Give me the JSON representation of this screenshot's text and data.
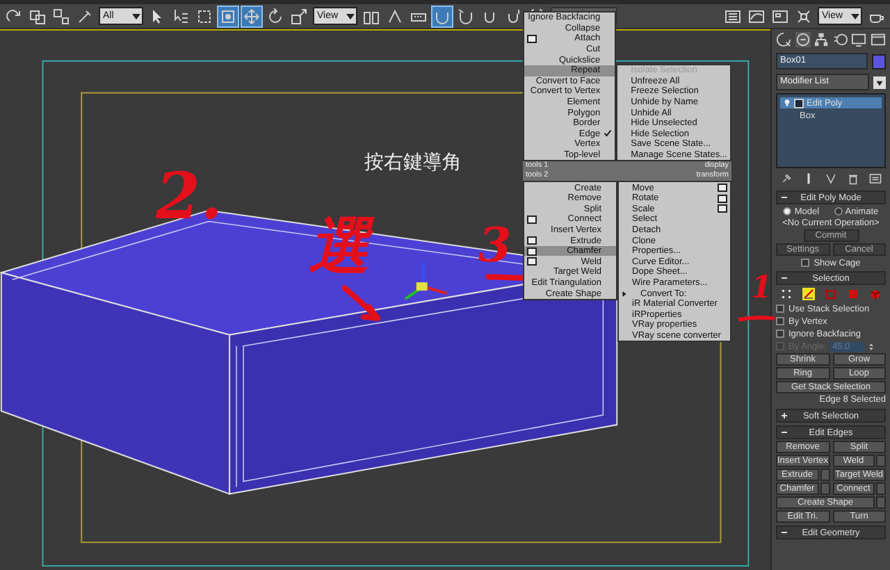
{
  "toolbar": {
    "tools_left": [
      {
        "selected": false
      },
      {
        "selected": false
      },
      {
        "selected": false
      },
      {
        "selected": false
      }
    ],
    "selection_filter": "All",
    "tools_select": [
      {
        "selected": false
      },
      {
        "selected": false
      },
      {
        "selected": false
      },
      {
        "selected": true
      },
      {
        "selected": true
      },
      {
        "selected": false
      },
      {
        "selected": false
      }
    ],
    "reference_coordinate": "View",
    "tools_snap": [
      {
        "selected": false
      },
      {
        "selected": false
      },
      {
        "selected": false
      },
      {
        "selected": true
      },
      {
        "selected": false
      },
      {
        "selected": false
      },
      {
        "selected": false
      }
    ],
    "tools_scene": [
      {
        "selected": false
      },
      {
        "selected": false
      },
      {
        "selected": false
      },
      {
        "selected": false
      }
    ],
    "view_dropdown": "View",
    "tools_render": [
      {
        "selected": false
      }
    ]
  },
  "viewport": {
    "caption": "按右鍵導角"
  },
  "annotations": [
    {
      "text": "2."
    },
    {
      "text": "選"
    },
    {
      "text": "3"
    },
    {
      "text": "1"
    }
  ],
  "quad_menu": {
    "tools_1": {
      "title": "tools 1",
      "items": [
        {
          "label": "Ignore Backfacing",
          "options": false,
          "checked": false,
          "highlighted": false,
          "disabled": false,
          "submenu": false
        },
        {
          "label": "Collapse",
          "options": false,
          "checked": false,
          "highlighted": false,
          "disabled": false,
          "submenu": false
        },
        {
          "label": "Attach",
          "options": true,
          "checked": false,
          "highlighted": false,
          "disabled": false,
          "submenu": false
        },
        {
          "label": "Cut",
          "options": false,
          "checked": false,
          "highlighted": false,
          "disabled": false,
          "submenu": false
        },
        {
          "label": "Quickslice",
          "options": false,
          "checked": false,
          "highlighted": false,
          "disabled": false,
          "submenu": false
        },
        {
          "label": "Repeat",
          "options": false,
          "checked": false,
          "highlighted": true,
          "disabled": false,
          "submenu": false
        },
        {
          "label": "Convert to Face",
          "options": false,
          "checked": false,
          "highlighted": false,
          "disabled": false,
          "submenu": false
        },
        {
          "label": "Convert to Vertex",
          "options": false,
          "checked": false,
          "highlighted": false,
          "disabled": false,
          "submenu": false
        },
        {
          "label": "Element",
          "options": false,
          "checked": false,
          "highlighted": false,
          "disabled": false,
          "submenu": false
        },
        {
          "label": "Polygon",
          "options": false,
          "checked": false,
          "highlighted": false,
          "disabled": false,
          "submenu": false
        },
        {
          "label": "Border",
          "options": false,
          "checked": false,
          "highlighted": false,
          "disabled": false,
          "submenu": false
        },
        {
          "label": "Edge",
          "options": false,
          "checked": true,
          "highlighted": false,
          "disabled": false,
          "submenu": false
        },
        {
          "label": "Vertex",
          "options": false,
          "checked": false,
          "highlighted": false,
          "disabled": false,
          "submenu": false
        },
        {
          "label": "Top-level",
          "options": false,
          "checked": false,
          "highlighted": false,
          "disabled": false,
          "submenu": false
        }
      ]
    },
    "display": {
      "title": "display",
      "items": [
        {
          "label": "Isolate Selection",
          "options": false,
          "checked": false,
          "highlighted": false,
          "disabled": true,
          "submenu": false
        },
        {
          "label": "Unfreeze All",
          "options": false,
          "checked": false,
          "highlighted": false,
          "disabled": false,
          "submenu": false
        },
        {
          "label": "Freeze Selection",
          "options": false,
          "checked": false,
          "highlighted": false,
          "disabled": false,
          "submenu": false
        },
        {
          "label": "Unhide by Name",
          "options": false,
          "checked": false,
          "highlighted": false,
          "disabled": false,
          "submenu": false
        },
        {
          "label": "Unhide All",
          "options": false,
          "checked": false,
          "highlighted": false,
          "disabled": false,
          "submenu": false
        },
        {
          "label": "Hide Unselected",
          "options": false,
          "checked": false,
          "highlighted": false,
          "disabled": false,
          "submenu": false
        },
        {
          "label": "Hide Selection",
          "options": false,
          "checked": false,
          "highlighted": false,
          "disabled": false,
          "submenu": false
        },
        {
          "label": "Save Scene State...",
          "options": false,
          "checked": false,
          "highlighted": false,
          "disabled": false,
          "submenu": false
        },
        {
          "label": "Manage Scene States...",
          "options": false,
          "checked": false,
          "highlighted": false,
          "disabled": false,
          "submenu": false
        }
      ]
    },
    "tools_2": {
      "title": "tools 2",
      "items": [
        {
          "label": "Create",
          "options": false,
          "checked": false,
          "highlighted": false,
          "disabled": false,
          "submenu": false
        },
        {
          "label": "Remove",
          "options": false,
          "checked": false,
          "highlighted": false,
          "disabled": false,
          "submenu": false
        },
        {
          "label": "Split",
          "options": false,
          "checked": false,
          "highlighted": false,
          "disabled": false,
          "submenu": false
        },
        {
          "label": "Connect",
          "options": true,
          "checked": false,
          "highlighted": false,
          "disabled": false,
          "submenu": false
        },
        {
          "label": "Insert Vertex",
          "options": false,
          "checked": false,
          "highlighted": false,
          "disabled": false,
          "submenu": false
        },
        {
          "label": "Extrude",
          "options": true,
          "checked": false,
          "highlighted": false,
          "disabled": false,
          "submenu": false
        },
        {
          "label": "Chamfer",
          "options": true,
          "checked": false,
          "highlighted": true,
          "disabled": false,
          "submenu": false
        },
        {
          "label": "Weld",
          "options": true,
          "checked": false,
          "highlighted": false,
          "disabled": false,
          "submenu": false
        },
        {
          "label": "Target Weld",
          "options": false,
          "checked": false,
          "highlighted": false,
          "disabled": false,
          "submenu": false
        },
        {
          "label": "Edit Triangulation",
          "options": false,
          "checked": false,
          "highlighted": false,
          "disabled": false,
          "submenu": false
        },
        {
          "label": "Create Shape",
          "options": false,
          "checked": false,
          "highlighted": false,
          "disabled": false,
          "submenu": false
        }
      ]
    },
    "transform": {
      "title": "transform",
      "items": [
        {
          "label": "Move",
          "options": true,
          "checked": false,
          "highlighted": false,
          "disabled": false,
          "submenu": false
        },
        {
          "label": "Rotate",
          "options": true,
          "checked": false,
          "highlighted": false,
          "disabled": false,
          "submenu": false
        },
        {
          "label": "Scale",
          "options": true,
          "checked": false,
          "highlighted": false,
          "disabled": false,
          "submenu": false
        },
        {
          "label": "Select",
          "options": false,
          "checked": false,
          "highlighted": false,
          "disabled": false,
          "submenu": false
        },
        {
          "label": "Detach",
          "options": false,
          "checked": false,
          "highlighted": false,
          "disabled": false,
          "submenu": false
        },
        {
          "label": "Clone",
          "options": false,
          "checked": false,
          "highlighted": false,
          "disabled": false,
          "submenu": false
        },
        {
          "label": "Properties...",
          "options": false,
          "checked": false,
          "highlighted": false,
          "disabled": false,
          "submenu": false
        },
        {
          "label": "Curve Editor...",
          "options": false,
          "checked": false,
          "highlighted": false,
          "disabled": false,
          "submenu": false
        },
        {
          "label": "Dope Sheet...",
          "options": false,
          "checked": false,
          "highlighted": false,
          "disabled": false,
          "submenu": false
        },
        {
          "label": "Wire Parameters...",
          "options": false,
          "checked": false,
          "highlighted": false,
          "disabled": false,
          "submenu": false
        },
        {
          "label": "Convert To:",
          "options": false,
          "checked": false,
          "highlighted": false,
          "disabled": false,
          "submenu": true
        },
        {
          "label": "iR Material Converter",
          "options": false,
          "checked": false,
          "highlighted": false,
          "disabled": false,
          "submenu": false
        },
        {
          "label": "iRProperties",
          "options": false,
          "checked": false,
          "highlighted": false,
          "disabled": false,
          "submenu": false
        },
        {
          "label": "VRay properties",
          "options": false,
          "checked": false,
          "highlighted": false,
          "disabled": false,
          "submenu": false
        },
        {
          "label": "VRay scene converter",
          "options": false,
          "checked": false,
          "highlighted": false,
          "disabled": false,
          "submenu": false
        }
      ]
    }
  },
  "command_panel": {
    "tabs": [
      {
        "selected": false
      },
      {
        "selected": true
      },
      {
        "selected": false
      },
      {
        "selected": false
      },
      {
        "selected": false
      },
      {
        "selected": false
      }
    ],
    "object_name": "Box01",
    "modifier_list": "Modifier List",
    "stack": [
      {
        "kind": "modifier",
        "label": "Edit Poly",
        "selected": true
      },
      {
        "kind": "base",
        "label": "Box",
        "selected": false
      }
    ],
    "rollouts": [
      {
        "kind": "edit_poly_mode",
        "title": "Edit Poly Mode",
        "expanded": true,
        "modes": [
          {
            "label": "Model",
            "selected": true
          },
          {
            "label": "Animate",
            "selected": false
          }
        ],
        "operation": "<No Current Operation>",
        "commit": {
          "label": "Commit",
          "disabled": true
        },
        "settings": {
          "label": "Settings",
          "disabled": true
        },
        "cancel": {
          "label": "Cancel",
          "disabled": true
        },
        "show_cage": {
          "label": "Show Cage",
          "checked": false
        }
      },
      {
        "kind": "selection",
        "title": "Selection",
        "expanded": true,
        "levels": [
          {
            "selected": false
          },
          {
            "selected": true
          },
          {
            "selected": false
          },
          {
            "selected": false
          },
          {
            "selected": false
          }
        ],
        "options": [
          {
            "label": "Use Stack Selection",
            "checked": false,
            "disabled": false
          },
          {
            "label": "By Vertex",
            "checked": false,
            "disabled": false
          },
          {
            "label": "Ignore Backfacing",
            "checked": false,
            "disabled": false
          },
          {
            "label": "By Angle:",
            "checked": false,
            "disabled": true
          }
        ],
        "angle": "45.0",
        "buttons": [
          [
            {
              "label": "Shrink",
              "options": false
            },
            {
              "label": "Grow",
              "options": false
            }
          ],
          [
            {
              "label": "Ring",
              "options": false
            },
            {
              "label": "Loop",
              "options": false
            }
          ],
          [
            {
              "label": "Get Stack Selection",
              "options": false
            }
          ]
        ],
        "status": "Edge 8 Selected"
      },
      {
        "kind": "buttons",
        "title": "Soft Selection",
        "expanded": false
      },
      {
        "kind": "buttons",
        "title": "Edit Edges",
        "expanded": true,
        "buttons": [
          [
            {
              "label": "Remove",
              "options": false
            },
            {
              "label": "Split",
              "options": false
            }
          ],
          [
            {
              "label": "Insert Vertex",
              "options": false
            },
            {
              "label": "Weld",
              "options": true
            }
          ],
          [
            {
              "label": "Extrude",
              "options": true
            },
            {
              "label": "Target Weld",
              "options": false
            }
          ],
          [
            {
              "label": "Chamfer",
              "options": true
            },
            {
              "label": "Connect",
              "options": true
            }
          ],
          [
            {
              "label": "Create Shape",
              "options": true
            }
          ],
          [
            {
              "label": "Edit Tri.",
              "options": false
            },
            {
              "label": "Turn",
              "options": false
            }
          ]
        ]
      },
      {
        "kind": "buttons",
        "title": "Edit Geometry",
        "expanded": true
      }
    ]
  }
}
